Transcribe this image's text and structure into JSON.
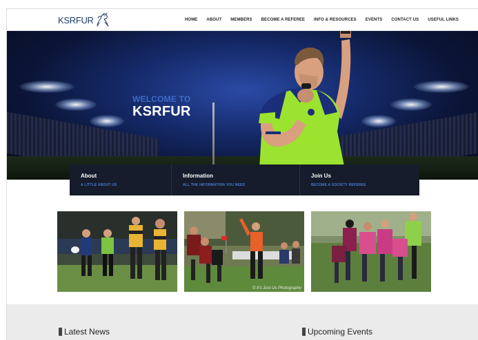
{
  "header": {
    "logo_text": "KSRFUR",
    "nav": [
      "HOME",
      "ABOUT",
      "MEMBERS",
      "BECOME A REFEREE",
      "INFO & RESOURCES",
      "EVENTS",
      "CONTACT US",
      "USEFUL LINKS"
    ]
  },
  "hero": {
    "welcome_small": "WELCOME TO",
    "welcome_big": "KSRFUR"
  },
  "infobar": [
    {
      "title": "About",
      "sub": "A LITTLE ABOUT US"
    },
    {
      "title": "Information",
      "sub": "ALL THE INFORMATION YOU NEED"
    },
    {
      "title": "Join Us",
      "sub": "BECOME A SOCIETY REFEREE"
    }
  ],
  "photos": {
    "watermark_1": "",
    "watermark_2": "© It's Just Us Photography",
    "watermark_3": ""
  },
  "sections": {
    "latest_news": "Latest News",
    "upcoming_events": "Upcoming Events"
  },
  "colors": {
    "accent": "#4a7bd6",
    "infobar_bg": "#161c2b",
    "referee_shirt": "#9be32e",
    "bottom_bg": "#ebebeb"
  }
}
